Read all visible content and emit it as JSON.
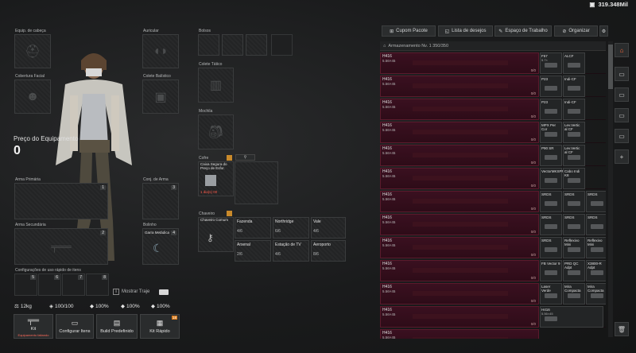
{
  "currency": {
    "value": "319.348Mil"
  },
  "equip": {
    "headgear": "Equip. de cabeça",
    "earpiece": "Auricular",
    "facecover": "Cobertura Facial",
    "armorvest": "Colete Balístico",
    "price_label": "Preço do Equipamento",
    "price_value": "0",
    "primary": "Arma Primária",
    "secondary": "Arma Secundária",
    "melee_sling": "Conj. de Arma",
    "scabbard": "Bolinho",
    "scabbard_item": "Garra Metádica",
    "quick_config": "Configurações de uso rápido de itens",
    "quick_slots": [
      "5",
      "6",
      "7",
      "8"
    ],
    "pockets": "Bolsos",
    "rig": "Colete Tático",
    "backpack": "Mochila",
    "secure": "Cofre",
    "secure_item": "Caixa Segura do Preço de Esfor.",
    "secure_time": "1 dia(s) 00",
    "keychain": "Chaveiro",
    "keychain_item": "Chaveiro Comum",
    "show_outfit": "Mostrar Traje"
  },
  "keys": [
    {
      "name": "Fazenda",
      "count": "4/6"
    },
    {
      "name": "Northridge",
      "count": "6/6"
    },
    {
      "name": "Vale",
      "count": "4/6"
    },
    {
      "name": "Arsenal",
      "count": "2/6"
    },
    {
      "name": "Estação de TV",
      "count": "4/6"
    },
    {
      "name": "Aeroporto",
      "count": "8/6"
    }
  ],
  "stats": {
    "weight": "12kg",
    "durability": "100/100",
    "s1": "100%",
    "s2": "100%",
    "s3": "100%",
    "s4": "100%"
  },
  "bottom": {
    "kit": "Kit",
    "kit_sub": "Equipamento faltando",
    "config": "Configurar Itens",
    "build": "Build Predefinido",
    "quick": "Kit Rápido",
    "quick_badge": "18"
  },
  "store": {
    "tabs": [
      "Cupom Pacote",
      "Lista de desejos",
      "Espaço de Trabalho",
      "Organizar"
    ],
    "header": "Armazenamento Nv. 1  350/350",
    "rows": [
      {
        "name": "H416",
        "cal": "5.56×45",
        "count": "0/0",
        "cells": [
          [
            "F57",
            "5.7×"
          ],
          [
            "ALCF",
            ""
          ]
        ]
      },
      {
        "name": "H416",
        "cal": "5.56×45",
        "count": "0/0",
        "cells": [
          [
            "P23",
            ""
          ],
          [
            "Indi-CF",
            ""
          ]
        ]
      },
      {
        "name": "H416",
        "cal": "5.56×45",
        "count": "0/0",
        "cells": [
          [
            "P23",
            ""
          ],
          [
            "Indi-CF",
            ""
          ]
        ]
      },
      {
        "name": "H416",
        "cal": "5.56×45",
        "count": "0/0",
        "cells": [
          [
            "MPX Per Cor",
            ""
          ],
          [
            "Lev.Vertic al CF",
            ""
          ]
        ]
      },
      {
        "name": "H416",
        "cal": "5.56×45",
        "count": "0/0",
        "cells": [
          [
            "P90 SR",
            ""
          ],
          [
            "Lev.Vertic al CF",
            ""
          ]
        ]
      },
      {
        "name": "H416",
        "cal": "5.56×45",
        "count": "0/0",
        "cells": [
          [
            "VectorMKSPR",
            ""
          ],
          [
            "Cabo Indi K8",
            ""
          ]
        ]
      },
      {
        "name": "H416",
        "cal": "5.56×45",
        "count": "0/0",
        "cells": [
          [
            "SRDS",
            ""
          ],
          [
            "SRDS",
            ""
          ],
          [
            "SRDS",
            ""
          ]
        ]
      },
      {
        "name": "H416",
        "cal": "5.56×45",
        "count": "0/0",
        "cells": [
          [
            "SRDS",
            ""
          ],
          [
            "SRDS",
            ""
          ],
          [
            "SRDS",
            ""
          ]
        ]
      },
      {
        "name": "H416",
        "cal": "5.56×45",
        "count": "0/0",
        "cells": [
          [
            "SRDS",
            ""
          ],
          [
            "Reflexivo Mini",
            ""
          ],
          [
            "Reflexivo Mini",
            ""
          ]
        ]
      },
      {
        "name": "H416",
        "cal": "5.56×45",
        "count": "0/0",
        "cells": [
          [
            "FB Vector 9",
            ""
          ],
          [
            "PRD QC Adpt",
            ""
          ],
          [
            "X3800-R Adpt",
            ""
          ]
        ]
      },
      {
        "name": "H416",
        "cal": "5.56×45",
        "count": "0/0",
        "cells": [
          [
            "Laser Verde",
            ""
          ],
          [
            "Mira Compacta",
            ""
          ],
          [
            "Mira Compacta",
            ""
          ]
        ]
      },
      {
        "name": "H416",
        "cal": "5.56×45",
        "count": "0/0",
        "cells": [
          [
            "H416",
            "5.56×45"
          ]
        ]
      },
      {
        "name": "H416",
        "cal": "5.56×45",
        "count": "0/0",
        "cells": []
      }
    ]
  },
  "icons": {
    "home": "home-icon",
    "box": "box-icon",
    "plus": "plus-icon",
    "trash": "trash-icon"
  }
}
